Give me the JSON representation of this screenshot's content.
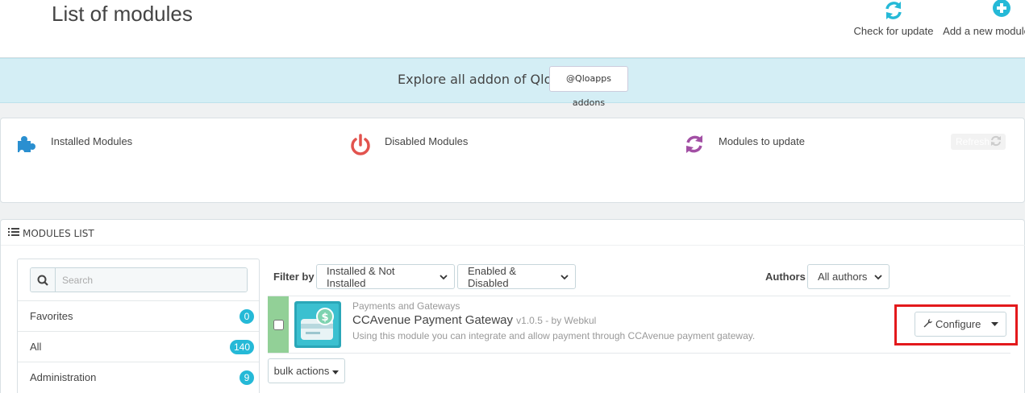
{
  "header": {
    "title": "List of modules",
    "toolbar": [
      {
        "label": "Check for update",
        "icon": "refresh-icon"
      },
      {
        "label": "Add a new module",
        "icon": "plus-circle-icon"
      }
    ]
  },
  "banner": {
    "text": "Explore all addon of Qloapps",
    "button": "@Qloapps addons"
  },
  "stats": {
    "installed": "Installed Modules",
    "disabled": "Disabled Modules",
    "to_update": "Modules to update",
    "refresh_label": "Refresh"
  },
  "modules_list": {
    "heading": "Modules list",
    "search_placeholder": "Search",
    "categories": [
      {
        "name": "Favorites",
        "count": "0"
      },
      {
        "name": "All",
        "count": "140"
      },
      {
        "name": "Administration",
        "count": "9"
      }
    ],
    "filter": {
      "label": "Filter by",
      "install_select": "Installed & Not Installed",
      "enabled_select": "Enabled & Disabled",
      "authors_label": "Authors",
      "authors_select": "All authors"
    },
    "module": {
      "category": "Payments and Gateways",
      "name": "CCAvenue Payment Gateway",
      "version": "v1.0.5 - by Webkul",
      "description": "Using this module you can integrate and allow payment through CCAvenue payment gateway.",
      "action_label": "Configure"
    },
    "bulk_actions": "bulk actions"
  },
  "colors": {
    "accent": "#25b9d7",
    "enabled_bar": "#92d097",
    "highlight": "#e3191c",
    "banner_bg": "#d4eef5"
  }
}
